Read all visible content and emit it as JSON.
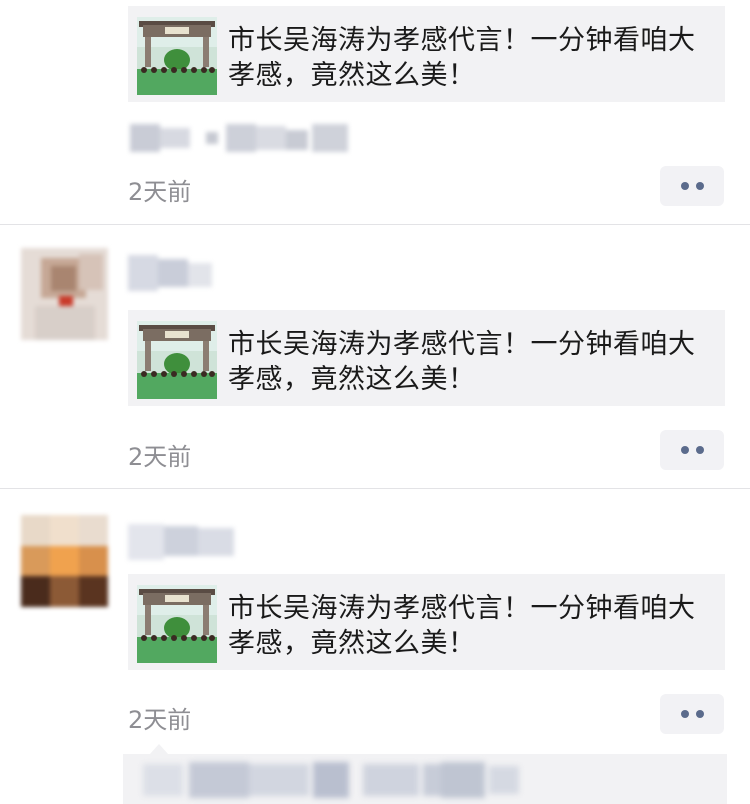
{
  "feed": {
    "posts": [
      {
        "card_title": "市长吴海涛为孝感代言！一分钟看咱大孝感，竟然这么美！",
        "time": "2天前"
      },
      {
        "card_title": "市长吴海涛为孝感代言！一分钟看咱大孝感，竟然这么美！",
        "time": "2天前"
      },
      {
        "card_title": "市长吴海涛为孝感代言！一分钟看咱大孝感，竟然这么美！",
        "time": "2天前"
      }
    ]
  },
  "icons": {
    "more": "more-dots-icon",
    "thumbnail": "article-thumbnail-image"
  },
  "colors": {
    "background": "#ffffff",
    "card_background": "#f2f2f4",
    "time_text": "#8e8e93",
    "link_dots": "#5b6b8c",
    "divider": "#e3e3e6"
  }
}
